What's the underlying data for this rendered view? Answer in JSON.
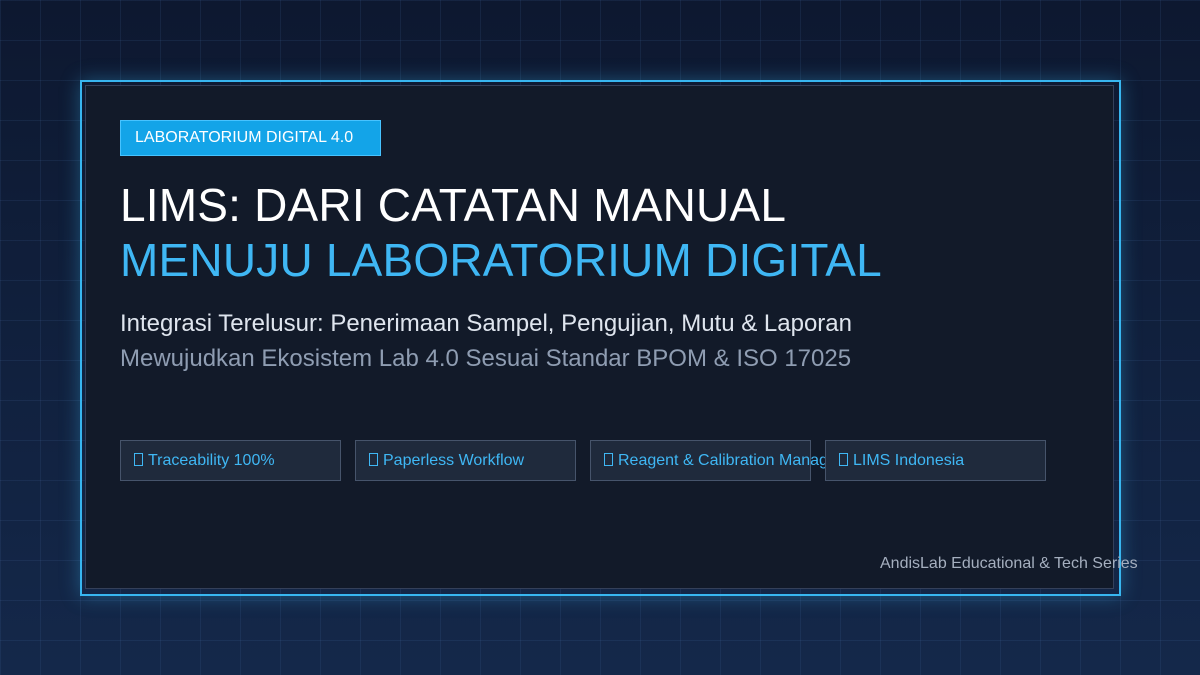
{
  "badge": {
    "label": "LABORATORIUM DIGITAL 4.0"
  },
  "title": {
    "line1": "LIMS: DARI CATATAN MANUAL",
    "line2": "MENUJU LABORATORIUM DIGITAL"
  },
  "subtitle": {
    "line1": "Integrasi Terelusur: Penerimaan Sampel, Pengujian, Mutu & Laporan",
    "line2": "Mewujudkan Ekosistem Lab 4.0 Sesuai Standar BPOM & ISO 17025"
  },
  "chips": [
    {
      "label": "Traceability 100%",
      "icon": "unknown-glyph-icon"
    },
    {
      "label": "Paperless Workflow",
      "icon": "unknown-glyph-icon"
    },
    {
      "label": "Reagent & Calibration Manag",
      "icon": "unknown-glyph-icon"
    },
    {
      "label": "LIMS Indonesia",
      "icon": "unknown-glyph-icon"
    }
  ],
  "footer": {
    "text": "AndisLab Educational & Tech Series"
  },
  "colors": {
    "accent": "#3fb7f4",
    "badge_bg": "#13a4e8",
    "card_bg": "#121a29",
    "page_bg": "#0d1830"
  }
}
